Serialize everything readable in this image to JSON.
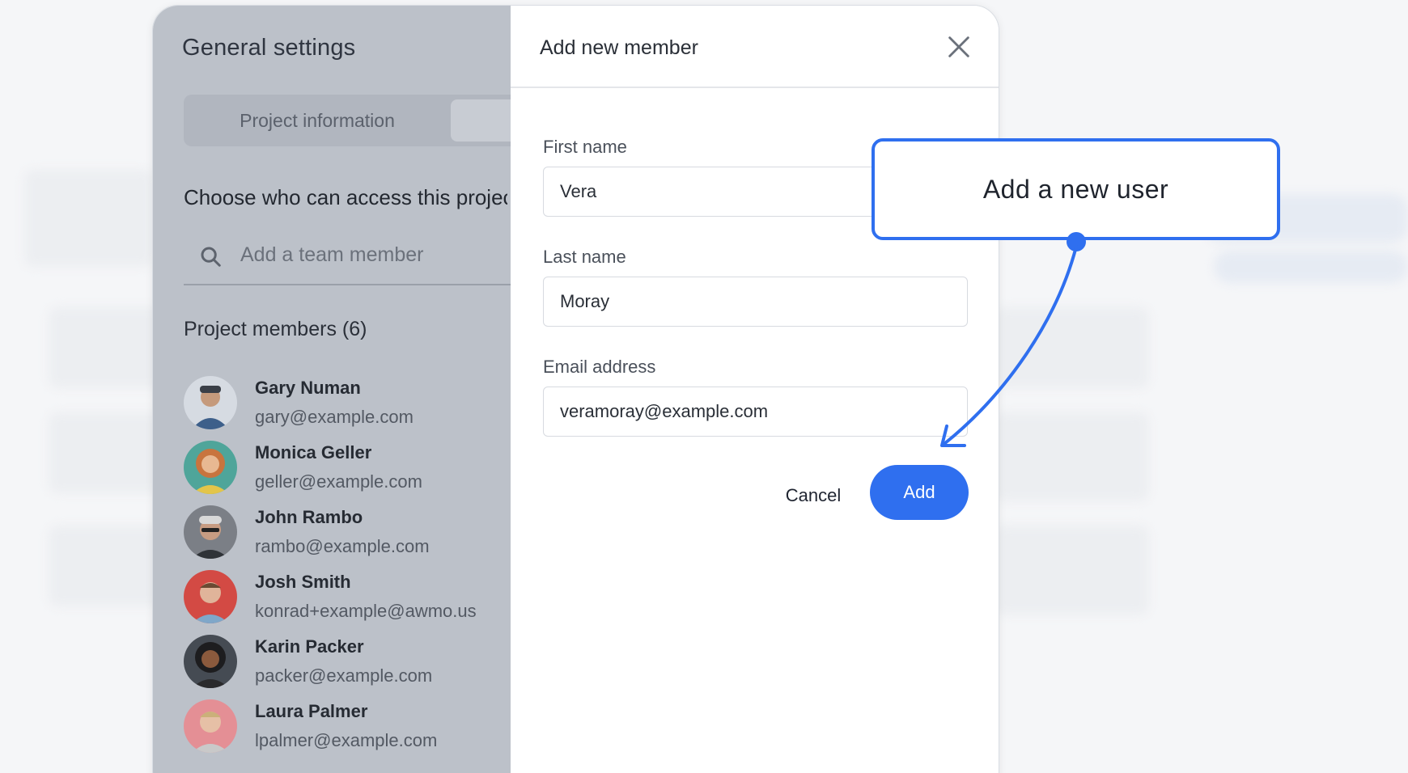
{
  "settings": {
    "title": "General settings",
    "tabs": [
      "Project information"
    ],
    "access_title": "Choose who can access this project",
    "search_placeholder": "Add a team member",
    "members_title": "Project members (6)",
    "members": [
      {
        "name": "Gary Numan",
        "email": "gary@example.com"
      },
      {
        "name": "Monica Geller",
        "email": "geller@example.com"
      },
      {
        "name": "John Rambo",
        "email": "rambo@example.com"
      },
      {
        "name": "Josh Smith",
        "email": "konrad+example@awmo.us"
      },
      {
        "name": "Karin Packer",
        "email": "packer@example.com"
      },
      {
        "name": "Laura Palmer",
        "email": "lpalmer@example.com"
      }
    ]
  },
  "dialog": {
    "title": "Add new member",
    "first_name_label": "First name",
    "first_name_value": "Vera",
    "last_name_label": "Last name",
    "last_name_value": "Moray",
    "email_label": "Email address",
    "email_value": "veramoray@example.com",
    "cancel_label": "Cancel",
    "add_label": "Add"
  },
  "callout": {
    "text": "Add a new user"
  },
  "colors": {
    "accent": "#2f6fef",
    "dim_panel": "#bcc1c9"
  }
}
